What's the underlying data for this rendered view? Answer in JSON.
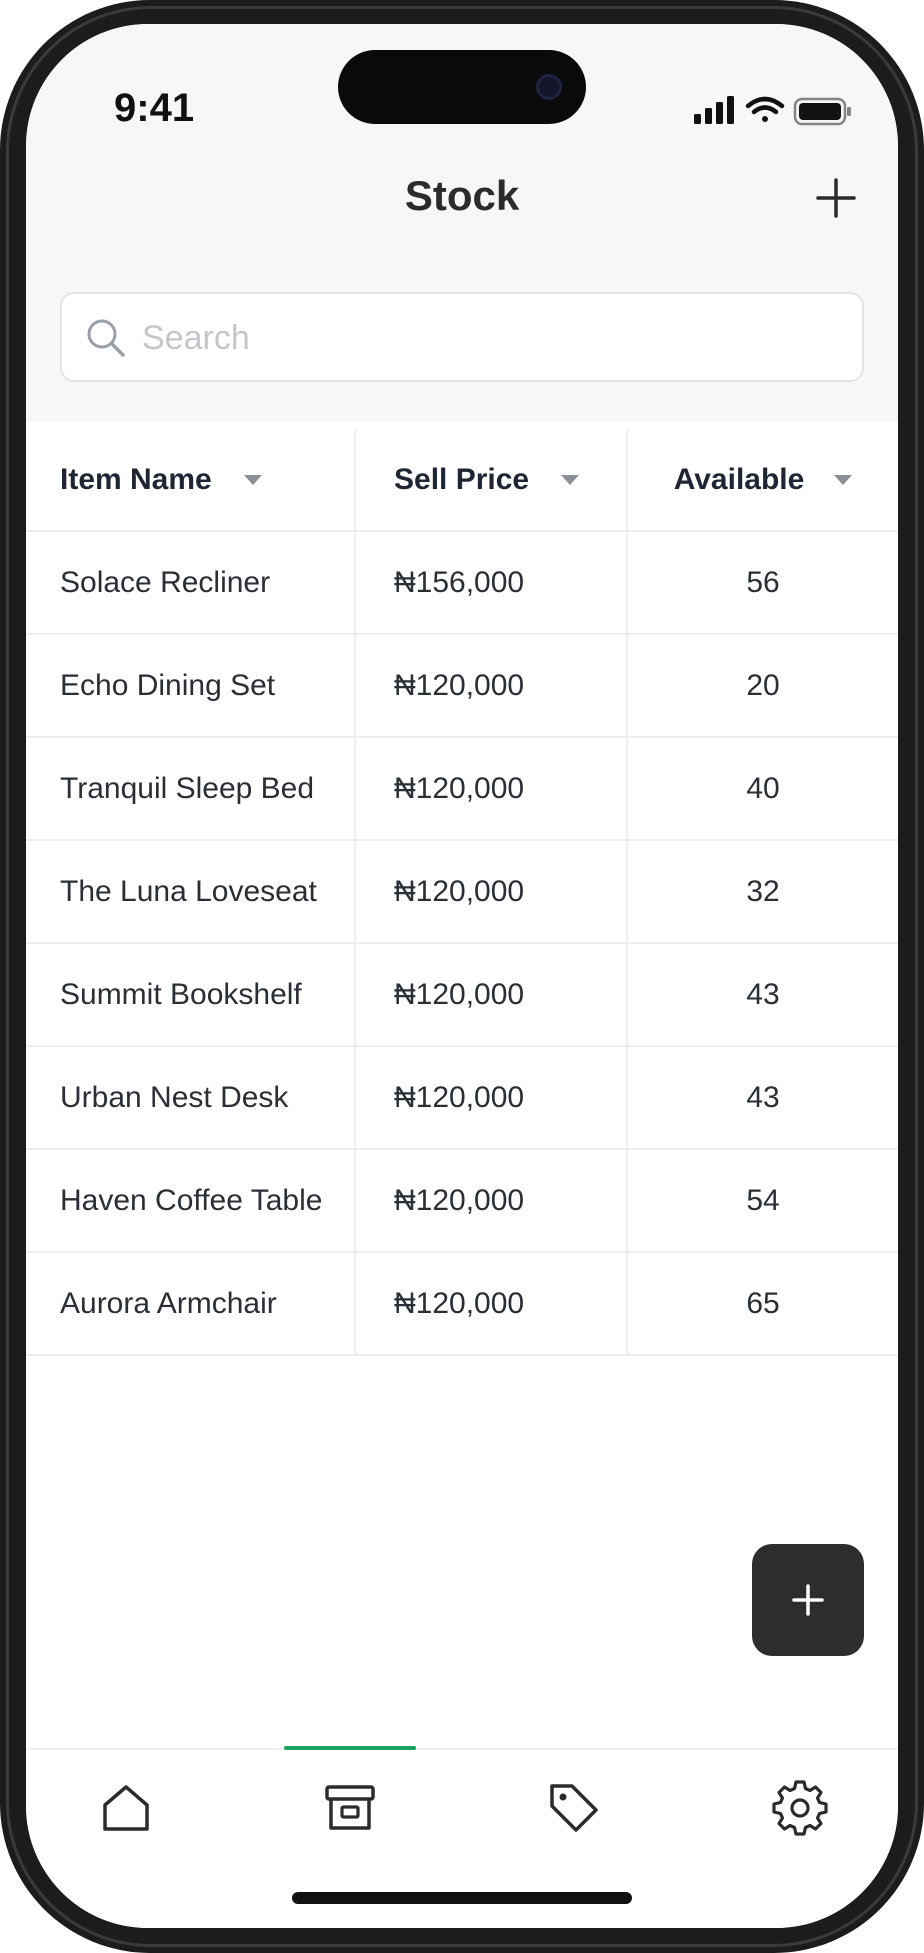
{
  "status_bar": {
    "time": "9:41"
  },
  "header": {
    "title": "Stock"
  },
  "search": {
    "placeholder": "Search",
    "value": ""
  },
  "table": {
    "columns": [
      {
        "label": "Item Name"
      },
      {
        "label": "Sell Price"
      },
      {
        "label": "Available"
      }
    ],
    "rows": [
      {
        "name": "Solace Recliner",
        "price": "₦156,000",
        "available": "56"
      },
      {
        "name": "Echo Dining Set",
        "price": "₦120,000",
        "available": "20"
      },
      {
        "name": "Tranquil Sleep Bed",
        "price": "₦120,000",
        "available": "40"
      },
      {
        "name": "The Luna Loveseat",
        "price": "₦120,000",
        "available": "32"
      },
      {
        "name": "Summit Bookshelf",
        "price": "₦120,000",
        "available": "43"
      },
      {
        "name": "Urban Nest Desk",
        "price": "₦120,000",
        "available": "43"
      },
      {
        "name": "Haven Coffee Table",
        "price": "₦120,000",
        "available": "54"
      },
      {
        "name": "Aurora Armchair",
        "price": "₦120,000",
        "available": "65"
      }
    ]
  },
  "tab_bar": {
    "items": [
      {
        "icon": "home-icon"
      },
      {
        "icon": "archive-box-icon",
        "active": true
      },
      {
        "icon": "tag-icon"
      },
      {
        "icon": "gear-icon"
      }
    ],
    "active_color": "#1aa260"
  },
  "colors": {
    "fab": "#2d2d2d",
    "header_bg": "#f6f7f9",
    "accent": "#1aa260"
  }
}
